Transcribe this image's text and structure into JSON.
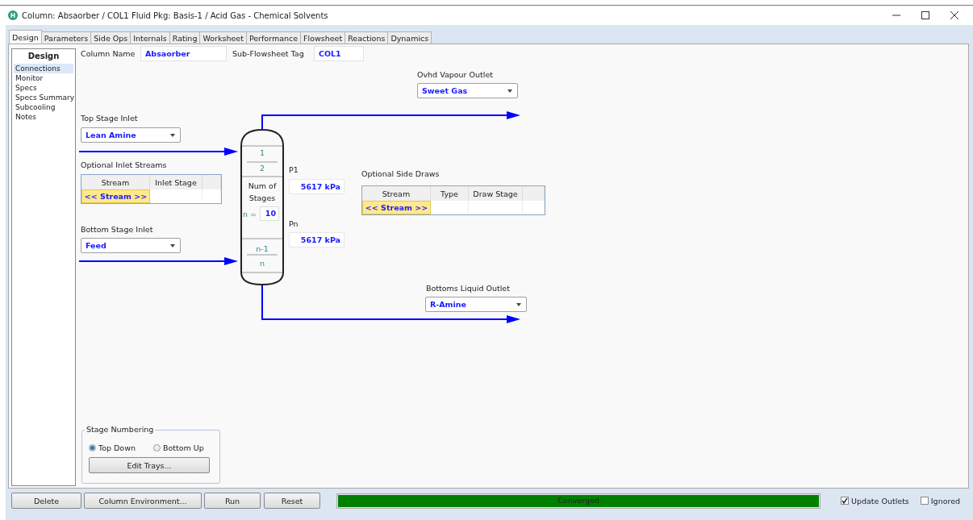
{
  "window": {
    "title": "Column: Absaorber / COL1  Fluid Pkg: Basis-1 / Acid Gas - Chemical Solvents"
  },
  "tabs": [
    {
      "label": "Design",
      "selected": true
    },
    {
      "label": "Parameters",
      "selected": false
    },
    {
      "label": "Side Ops",
      "selected": false
    },
    {
      "label": "Internals",
      "selected": false
    },
    {
      "label": "Rating",
      "selected": false
    },
    {
      "label": "Worksheet",
      "selected": false
    },
    {
      "label": "Performance",
      "selected": false
    },
    {
      "label": "Flowsheet",
      "selected": false
    },
    {
      "label": "Reactions",
      "selected": false
    },
    {
      "label": "Dynamics",
      "selected": false
    }
  ],
  "sidebar": {
    "title": "Design",
    "items": [
      {
        "label": "Connections",
        "selected": true
      },
      {
        "label": "Monitor",
        "selected": false
      },
      {
        "label": "Specs",
        "selected": false
      },
      {
        "label": "Specs Summary",
        "selected": false
      },
      {
        "label": "Subcooling",
        "selected": false
      },
      {
        "label": "Notes",
        "selected": false
      }
    ]
  },
  "column_name": {
    "label": "Column Name",
    "value": "Absaorber"
  },
  "sub_flowsheet_tag": {
    "label": "Sub-Flowsheet Tag",
    "value": "COL1"
  },
  "ovhd_vapour_outlet": {
    "label": "Ovhd Vapour Outlet",
    "value": "Sweet Gas"
  },
  "top_stage_inlet": {
    "label": "Top Stage Inlet",
    "value": "Lean Amine"
  },
  "optional_inlet_streams": {
    "label": "Optional Inlet Streams",
    "columns": [
      "Stream",
      "Inlet Stage"
    ],
    "rows": [
      [
        "<< Stream >>",
        ""
      ]
    ]
  },
  "bottom_stage_inlet": {
    "label": "Bottom Stage Inlet",
    "value": "Feed"
  },
  "bottoms_liquid_outlet": {
    "label": "Bottoms Liquid Outlet",
    "value": "R-Amine"
  },
  "column": {
    "top_stages": [
      "1",
      "2"
    ],
    "num_label": "Num of Stages",
    "n_label": "n =",
    "n_value": "10",
    "bottom_stages": [
      "n-1",
      "n"
    ]
  },
  "p1": {
    "label": "P1",
    "value": "5617 kPa"
  },
  "pn": {
    "label": "Pn",
    "value": "5617 kPa"
  },
  "optional_side_draws": {
    "label": "Optional Side Draws",
    "columns": [
      "Stream",
      "Type",
      "Draw Stage"
    ],
    "rows": [
      [
        "<< Stream >>",
        "",
        ""
      ]
    ]
  },
  "stage_numbering": {
    "title": "Stage Numbering",
    "options": [
      {
        "label": "Top Down",
        "selected": true
      },
      {
        "label": "Bottom Up",
        "selected": false
      }
    ],
    "button": "Edit Trays..."
  },
  "buttons": [
    "Delete",
    "Column Environment...",
    "Run",
    "Reset"
  ],
  "status": {
    "text": "Converged",
    "level": 1
  },
  "checkboxes": [
    {
      "label": "Update Outlets",
      "checked": true
    },
    {
      "label": "Ignored",
      "checked": false
    }
  ]
}
